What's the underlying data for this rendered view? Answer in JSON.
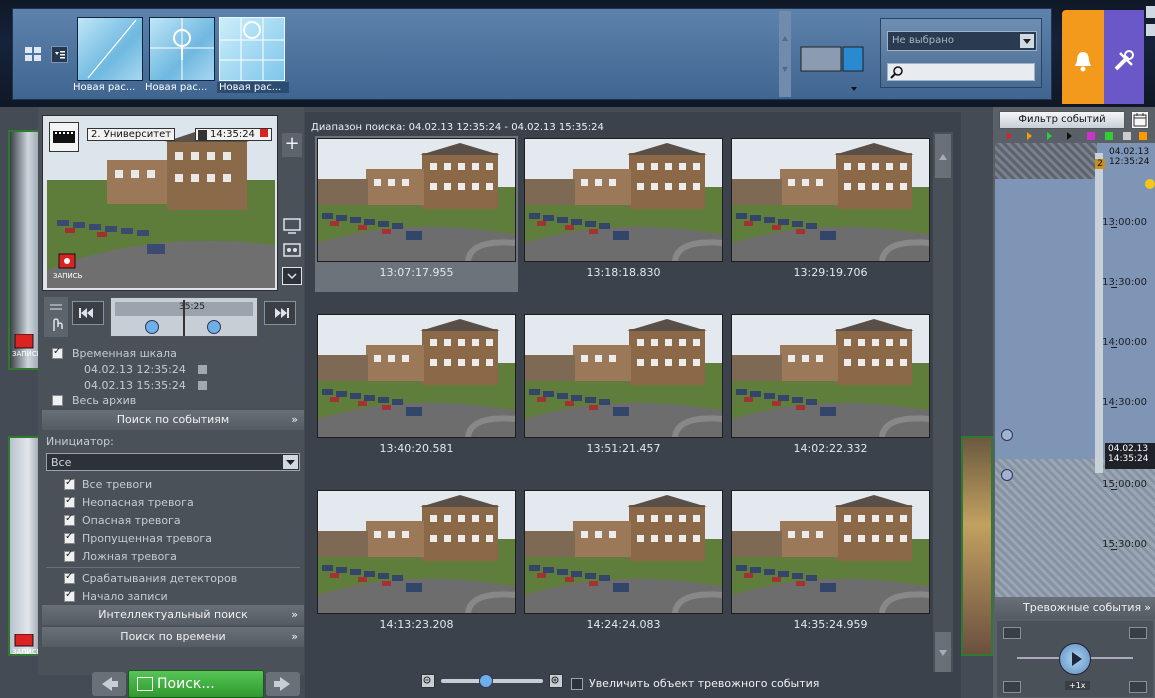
{
  "layouts": [
    {
      "label": "Новая рас..."
    },
    {
      "label": "Новая рас..."
    },
    {
      "label": "Новая рас..."
    }
  ],
  "camera_select": {
    "value": "Не выбрано"
  },
  "camera_view": {
    "name": "2. Университет",
    "time": "14:35:24",
    "rec_label": "ЗАПИСЬ",
    "timeline_time": "35:25"
  },
  "left_panel": {
    "timescale_label": "Временная шкала",
    "range_start": "04.02.13 12:35:24",
    "range_end": "04.02.13 15:35:24",
    "whole_archive": "Весь архив",
    "event_search": "Поиск по событиям",
    "initiator_label": "Инициатор:",
    "initiator_value": "Все",
    "checks": [
      "Все тревоги",
      "Неопасная тревога",
      "Опасная тревога",
      "Пропущенная тревога",
      "Ложная тревога"
    ],
    "checks2": [
      "Срабатывания детекторов",
      "Начало записи"
    ],
    "intel_search": "Интеллектуальный поиск",
    "time_search": "Поиск по времени",
    "side_rec1": "ЗАПИСЬ",
    "side_rec2": "ЗАПИСЬ"
  },
  "search": {
    "range": "Диапазон поиска:  04.02.13 12:35:24 - 04.02.13 15:35:24",
    "thumbs": [
      "13:07:17.955",
      "13:18:18.830",
      "13:29:19.706",
      "13:40:20.581",
      "13:51:21.457",
      "14:02:22.332",
      "14:13:23.208",
      "14:24:24.083",
      "14:35:24.959"
    ],
    "enlarge_label": "Увеличить объект тревожного события",
    "search_button": "Поиск..."
  },
  "right_panel": {
    "filter_button": "Фильтр событий",
    "start_date": "04.02.13",
    "start_time": "12:35:24",
    "marker_badge": "2",
    "ticks": [
      "13:00:00",
      "13:30:00",
      "14:00:00",
      "14:30:00",
      "15:00:00",
      "15:30:00"
    ],
    "current_date": "04.02.13",
    "current_time": "14:35:24",
    "alarms_label": "Тревожные события",
    "speed_label": "+1x"
  },
  "colors": {
    "alarm_tab": "#f39a1c",
    "settings_tab": "#6b58c8",
    "accent_green": "#3fae3f"
  }
}
